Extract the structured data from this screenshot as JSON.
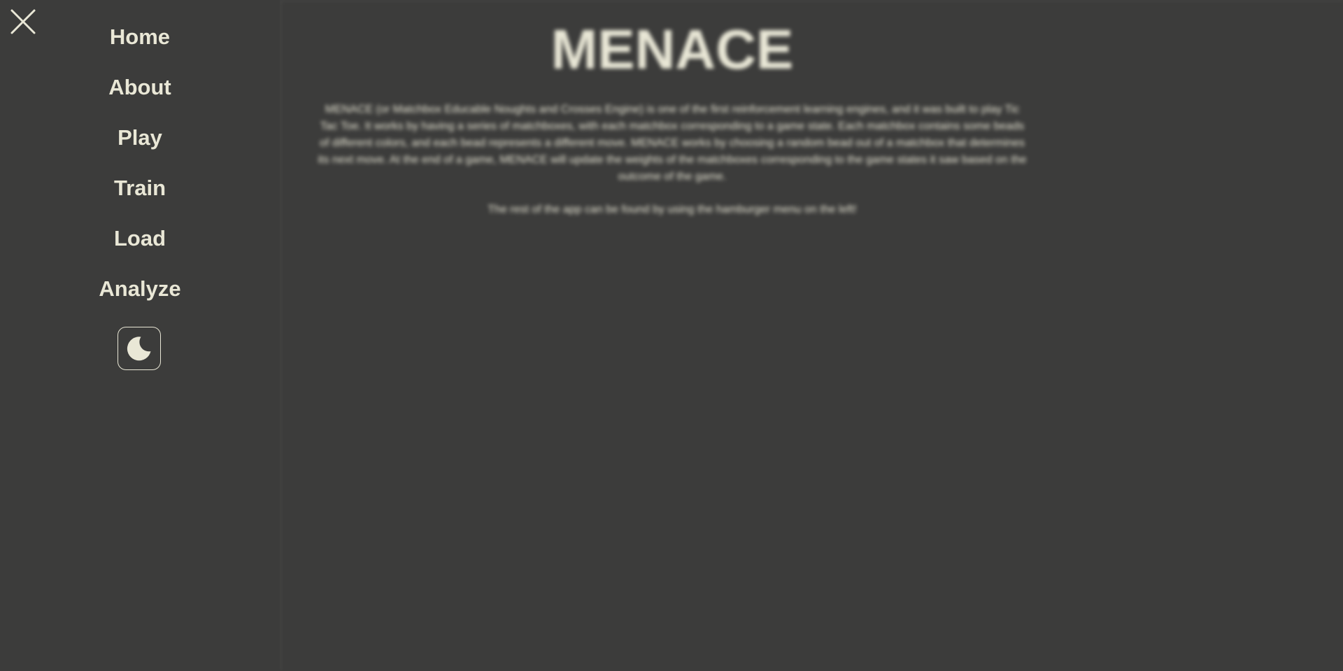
{
  "main": {
    "title": "MENACE",
    "description": "MENACE (or Matchbox Educable Noughts and Crosses Engine) is one of the first reinforcement learning engines, and it was built to play Tic Tac Toe. It works by having a series of matchboxes, with each matchbox corresponding to a game state. Each matchbox contains some beads of different colors, and each bead represents a different move. MENACE works by choosing a random bead out of a matchbox that determines its next move. At the end of a game, MENACE will update the weights of the matchboxes corresponding to the game states it saw based on the outcome of the game.",
    "hint": "The rest of the app can be found by using the hamburger menu on the left!"
  },
  "sidebar": {
    "close_icon": "close-icon",
    "items": [
      {
        "label": "Home"
      },
      {
        "label": "About"
      },
      {
        "label": "Play"
      },
      {
        "label": "Train"
      },
      {
        "label": "Load"
      },
      {
        "label": "Analyze"
      }
    ],
    "theme_toggle_icon": "moon-icon"
  },
  "colors": {
    "background": "#3c3c3b",
    "text": "#e9e7d6"
  }
}
